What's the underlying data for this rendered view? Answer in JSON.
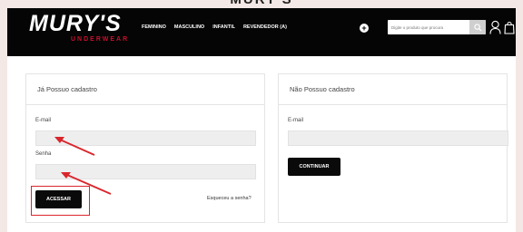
{
  "top_caption": "MURY'S",
  "header": {
    "logo_main": "MURY'S",
    "logo_sub": "UNDERWEAR",
    "nav": [
      "FEMININO",
      "MASCULINO",
      "INFANTIL",
      "REVENDEDOR (A)"
    ],
    "search": {
      "placeholder": "Digite o produto que procura"
    }
  },
  "login_panel": {
    "title": "Já Possuo cadastro",
    "email_label": "E-mail",
    "password_label": "Senha",
    "submit_label": "ACESSAR",
    "forgot_label": "Esqueceu a senha?"
  },
  "register_panel": {
    "title": "Não Possuo cadastro",
    "email_label": "E-mail",
    "continue_label": "CONTINUAR"
  },
  "colors": {
    "annotation": "#d9262c",
    "header_bg": "#050505",
    "logo_accent": "#c8102e"
  },
  "icons": [
    "plus-circle-icon",
    "search-icon",
    "user-icon",
    "shopping-bag-icon"
  ]
}
